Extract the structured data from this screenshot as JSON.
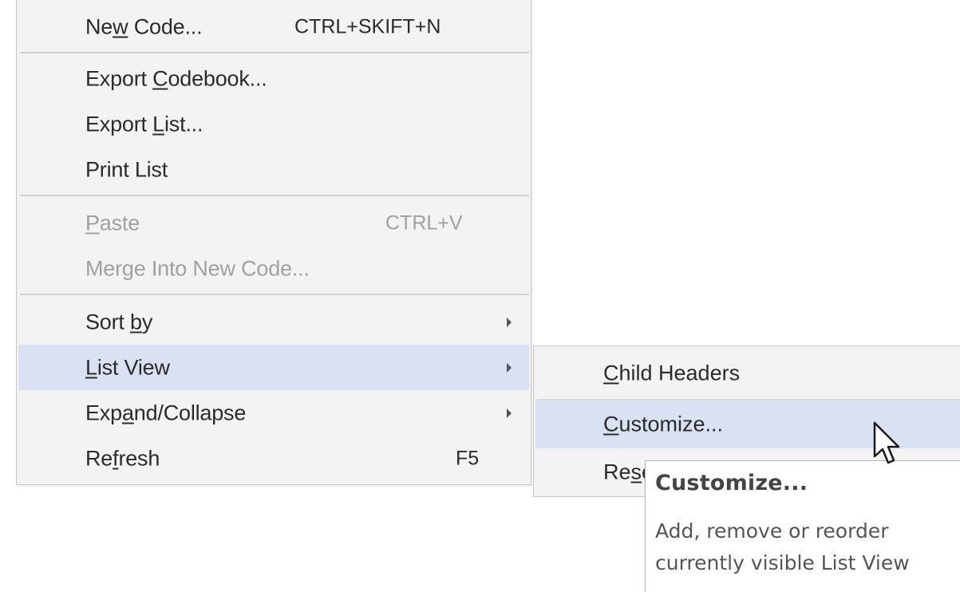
{
  "context_menu": {
    "items": [
      {
        "label_pre": "Ne",
        "label_key": "w",
        "label_post": " Code...",
        "shortcut": "CTRL+SKIFT+N"
      },
      {
        "label_pre": "Export ",
        "label_key": "C",
        "label_post": "odebook..."
      },
      {
        "label_pre": "Export ",
        "label_key": "L",
        "label_post": "ist..."
      },
      {
        "label": "Print List"
      },
      {
        "label_pre": "",
        "label_key": "P",
        "label_post": "aste",
        "shortcut": "CTRL+V",
        "disabled": true
      },
      {
        "label_pre": "Mer",
        "label_key": "g",
        "label_post": "e Into New Code...",
        "disabled": true
      },
      {
        "label_pre": "Sort ",
        "label_key": "b",
        "label_post": "y",
        "submenu": true
      },
      {
        "label_pre": "",
        "label_key": "L",
        "label_post": "ist View",
        "submenu": true,
        "highlighted": true
      },
      {
        "label_pre": "Exp",
        "label_key": "a",
        "label_post": "nd/Collapse",
        "submenu": true
      },
      {
        "label_pre": "Re",
        "label_key": "f",
        "label_post": "resh",
        "shortcut": "F5"
      }
    ]
  },
  "list_view_submenu": {
    "items": [
      {
        "label_pre": "",
        "label_key": "C",
        "label_post": "hild Headers"
      },
      {
        "label_pre": "",
        "label_key": "C",
        "label_post": "ustomize...",
        "highlighted": true
      },
      {
        "label_pre": "Re",
        "label_key": "s",
        "label_post": "et"
      }
    ]
  },
  "tooltip": {
    "title": "Customize...",
    "body_line1": "Add, remove or reorder",
    "body_line2": "currently visible List View"
  },
  "colors": {
    "menu_bg": "#f3f3f3",
    "highlight": "#d9e1f2",
    "disabled_text": "#a0a0a0"
  },
  "icons": {
    "submenu_arrow": "chevron-right-icon",
    "cursor": "mouse-pointer-icon"
  }
}
